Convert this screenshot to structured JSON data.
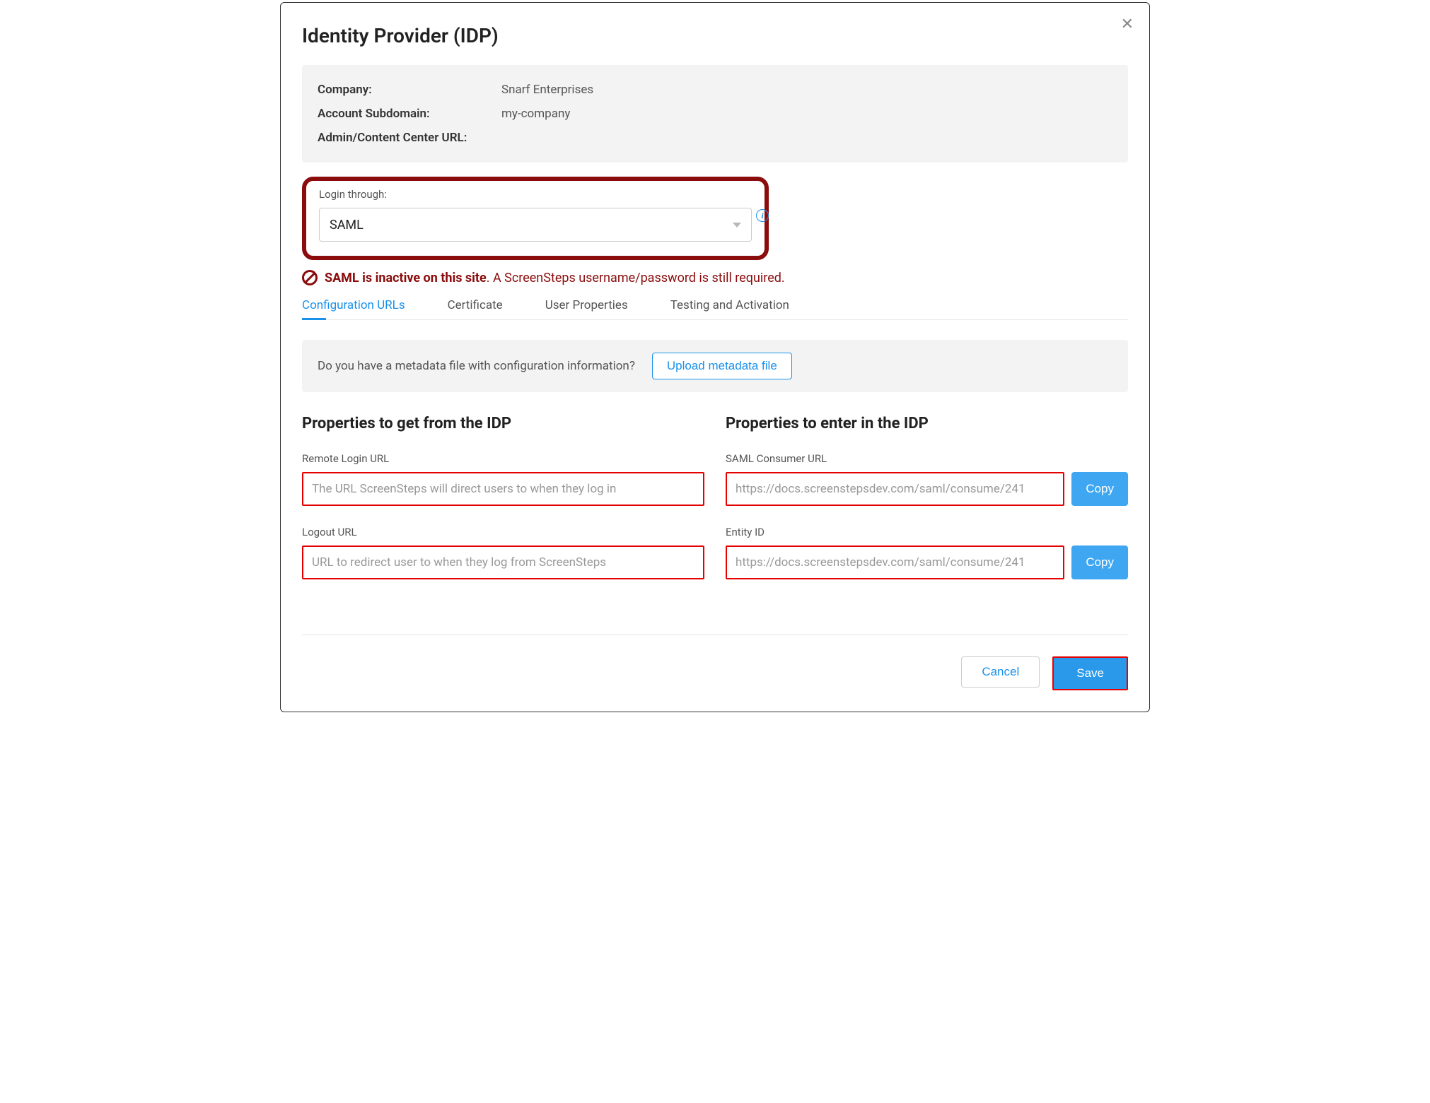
{
  "title": "Identity Provider (IDP)",
  "info": {
    "company_label": "Company:",
    "company_value": "Snarf Enterprises",
    "subdomain_label": "Account Subdomain:",
    "subdomain_value": "my-company",
    "admin_url_label": "Admin/Content Center URL:",
    "admin_url_value": ""
  },
  "login": {
    "label": "Login through:",
    "selected": "SAML"
  },
  "status": {
    "bold": "SAML is inactive on this site",
    "rest": ". A ScreenSteps username/password is still required."
  },
  "tabs": {
    "t1": "Configuration URLs",
    "t2": "Certificate",
    "t3": "User Properties",
    "t4": "Testing and Activation"
  },
  "upload": {
    "question": "Do you have a metadata file with configuration information?",
    "button": "Upload metadata file"
  },
  "left": {
    "heading": "Properties to get from the IDP",
    "f1_label": "Remote Login URL",
    "f1_placeholder": "The URL ScreenSteps will direct users to when they log in",
    "f2_label": "Logout URL",
    "f2_placeholder": "URL to redirect user to when they log from ScreenSteps"
  },
  "right": {
    "heading": "Properties to enter in the IDP",
    "f1_label": "SAML Consumer URL",
    "f1_value": "https://docs.screenstepsdev.com/saml/consume/241",
    "f2_label": "Entity ID",
    "f2_value": "https://docs.screenstepsdev.com/saml/consume/241",
    "copy": "Copy"
  },
  "actions": {
    "cancel": "Cancel",
    "save": "Save"
  }
}
